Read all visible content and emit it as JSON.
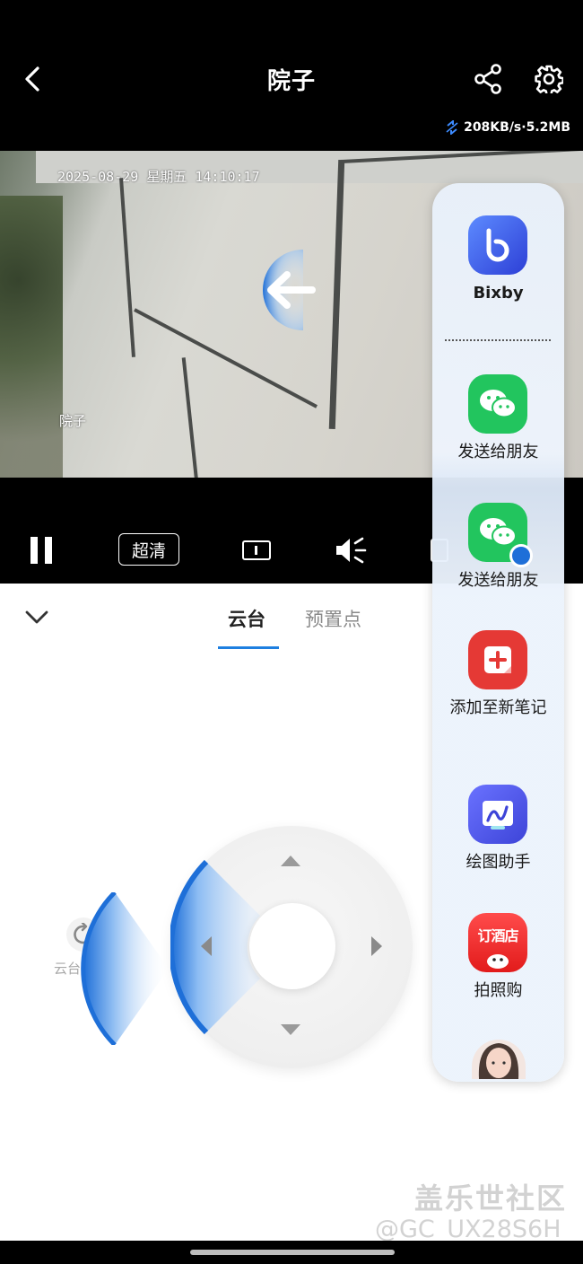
{
  "header": {
    "title": "院子",
    "rate": "208KB/s·5.2MB"
  },
  "video": {
    "osd_time": "2025-08-29 星期五 14:10:17",
    "osd_name": "院子"
  },
  "controls": {
    "quality": "超清"
  },
  "panel": {
    "tabs": [
      {
        "label": "云台",
        "active": true
      },
      {
        "label": "预置点",
        "active": false
      }
    ],
    "reset_label": "云台复位"
  },
  "edge_panel": {
    "items": [
      {
        "label": "Bixby",
        "icon": "bixby-icon"
      },
      {
        "label": "发送给朋友",
        "icon": "wechat-icon"
      },
      {
        "label": "发送给朋友",
        "icon": "wechat-dual-icon"
      },
      {
        "label": "添加至新笔记",
        "icon": "notes-add-icon"
      },
      {
        "label": "绘图助手",
        "icon": "drawing-assist-icon"
      },
      {
        "label": "拍照购",
        "icon": "hotel-booking-icon",
        "icon_text": "订酒店"
      }
    ]
  },
  "watermark": {
    "site": "盖乐世社区",
    "user": "@GC_UX28S6H"
  },
  "colors": {
    "accent": "#1e7fe0",
    "wechat": "#22c55e",
    "notes": "#e53935",
    "bixby": "#3b5bdb"
  }
}
